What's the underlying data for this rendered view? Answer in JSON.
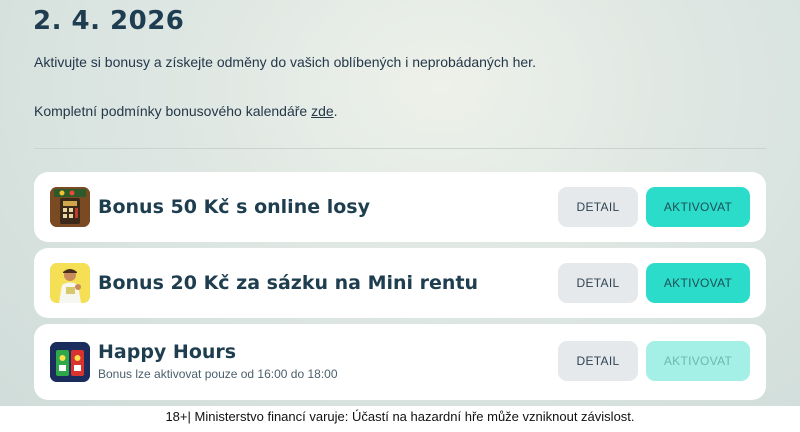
{
  "header": {
    "date": "2. 4. 2026",
    "intro": "Aktivujte si bonusy a získejte odměny do vašich oblíbených i neprobádaných her.",
    "terms_prefix": "Kompletní podmínky bonusového kalendáře ",
    "terms_link": "zde",
    "terms_suffix": "."
  },
  "bonuses": [
    {
      "title": "Bonus 50 Kč s online losy",
      "icon": "lottery-ticket-icon",
      "detail_label": "DETAIL",
      "activate_label": "AKTIVOVAT",
      "activate_enabled": true
    },
    {
      "title": "Bonus 20 Kč za sázku na Mini rentu",
      "icon": "mini-renta-icon",
      "detail_label": "DETAIL",
      "activate_label": "AKTIVOVAT",
      "activate_enabled": true
    },
    {
      "title": "Happy Hours",
      "subtitle": "Bonus lze aktivovat pouze od 16:00 do 18:00",
      "icon": "happy-hours-icon",
      "detail_label": "DETAIL",
      "activate_label": "AKTIVOVAT",
      "activate_enabled": false
    }
  ],
  "footer": {
    "text": "18+| Ministerstvo financí varuje: Účastí na hazardní hře může vzniknout závislost."
  },
  "colors": {
    "accent": "#2cdccb",
    "accent_disabled": "#a4efe6",
    "title": "#1e3e50"
  }
}
